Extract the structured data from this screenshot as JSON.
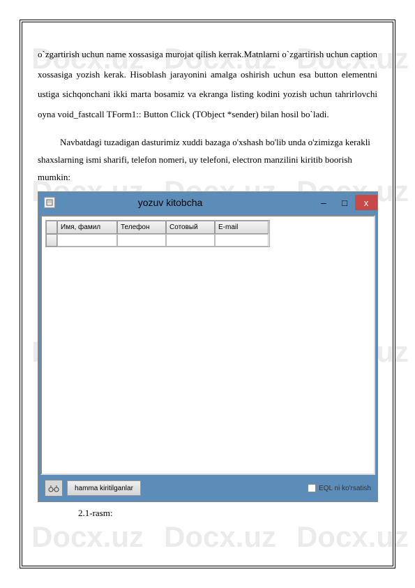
{
  "watermark": "Docx.uz",
  "paragraph1": "o`zgartirish uchun name xossasiga murojat qilish kerrak.Matnlarni o`zgartirish uchun caption xossasiga yozish kerak. Hisoblash jarayonini amalga oshirish uchun esa button elementni ustiga sichqonchani ikki marta bosamiz va ekranga listing kodini yozish uchun tahrirlovchi oyna void_fastcall TForm1:: Button Click (TObject *sender) bilan hosil bo`ladi.",
  "paragraph2": "Navbatdagi tuzadigan dasturimiz xuddi bazaga o'xshash bo'lib unda o'zimizga kerakli shaxslarning ismi sharifi, telefon nomeri, uy telefoni, electron manzilini kiritib boorish mumkin:",
  "app": {
    "title": "yozuv kitobcha",
    "minimize": "–",
    "maximize": "□",
    "close": "x",
    "grid": {
      "headers": [
        "Имя, фамил",
        "Телефон",
        "Сотовый",
        "E-mail"
      ]
    },
    "bottomButton": "hamma kiritilganlar",
    "checkboxLabel": "EQL ni ko'rsatish",
    "binocularsIcon": "👓"
  },
  "caption": "2.1-rasm:"
}
